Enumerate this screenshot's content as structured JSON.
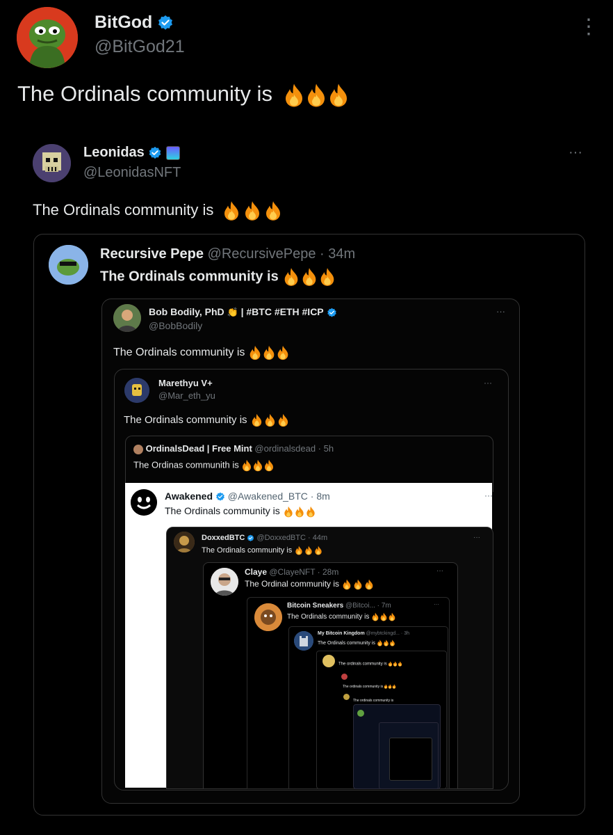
{
  "main": {
    "name": "BitGod",
    "handle": "@BitGod21",
    "text": "The Ordinals community is",
    "menu": "⋮"
  },
  "quote1": {
    "name": "Leonidas",
    "handle": "@LeonidasNFT",
    "text": "The Ordinals community is",
    "menu": "···"
  },
  "quote2": {
    "name": "Recursive Pepe",
    "handle": "@RecursivePepe · 34m",
    "text": "The Ordinals community is"
  },
  "quote3": {
    "name": "Bob Bodily, PhD",
    "name_suffix": "| #BTC #ETH #ICP",
    "handle": "@BobBodily",
    "text": "The Ordinals community is",
    "menu": "···"
  },
  "quote4": {
    "name": "Marethyu V+",
    "handle": "@Mar_eth_yu",
    "text": "The Ordinals community is",
    "menu": "···"
  },
  "quote5": {
    "name": "OrdinalsDead | Free Mint",
    "handle": "@ordinalsdead · 5h",
    "text": "The Ordinas communith is"
  },
  "quote6": {
    "name": "Awakened",
    "handle": "@Awakened_BTC · 8m",
    "text": "The Ordinals community is",
    "menu": "···"
  },
  "quote7": {
    "name": "DoxxedBTC",
    "handle": "@DoxxedBTC · 44m",
    "text": "The Ordinals community is",
    "menu": "···"
  },
  "quote8": {
    "name": "Claye",
    "handle": "@ClayeNFT · 28m",
    "text": "The Ordinal community is",
    "menu": "···"
  },
  "quote9": {
    "name": "Bitcoin Sneakers",
    "handle": "@Bitcoi... · 7m",
    "text": "The Ordinals community is",
    "menu": "···"
  },
  "quote10": {
    "name": "My Bitcoin Kingdom",
    "handle": "@mybtckingd... · 3h",
    "text": "The Ordinals community is"
  },
  "quote11": {
    "text": "The ordinals community is"
  },
  "quote12": {
    "text": "The ordinals community is"
  },
  "quote13": {
    "text": "The ordinals community is"
  },
  "colors": {
    "background": "#000000",
    "verified": "#1d9bf0",
    "handle": "#71767b",
    "border": "#2f3336",
    "fire": "#f4900c"
  },
  "icons": [
    "avatar-pepe",
    "verified-badge-icon",
    "fire-icon",
    "more-icon"
  ]
}
